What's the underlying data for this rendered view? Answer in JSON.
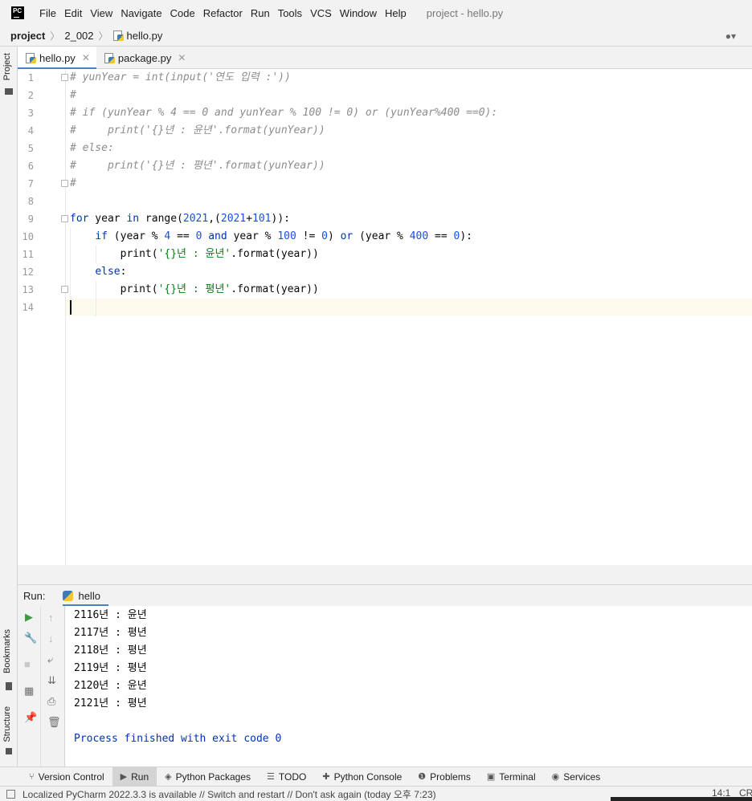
{
  "app": {
    "logo": "PC",
    "title": "project - hello.py"
  },
  "menu": [
    "File",
    "Edit",
    "View",
    "Navigate",
    "Code",
    "Refactor",
    "Run",
    "Tools",
    "VCS",
    "Window",
    "Help"
  ],
  "breadcrumb": {
    "project": "project",
    "folder": "2_002",
    "file": "hello.py"
  },
  "left_stripe": {
    "top": "Project",
    "bookmarks": "Bookmarks",
    "structure": "Structure"
  },
  "tabs": [
    {
      "label": "hello.py",
      "active": true
    },
    {
      "label": "package.py",
      "active": false
    }
  ],
  "line_numbers": [
    "1",
    "2",
    "3",
    "4",
    "5",
    "6",
    "7",
    "8",
    "9",
    "10",
    "11",
    "12",
    "13",
    "14"
  ],
  "code": [
    "# yunYear = int(input('연도 입력 :'))",
    "#",
    "# if (yunYear % 4 == 0 and yunYear % 100 != 0) or (yunYear%400 ==0):",
    "#     print('{}년 : 윤년'.format(yunYear))",
    "# else:",
    "#     print('{}년 : 평년'.format(yunYear))",
    "#",
    "",
    "for year in range(2021,(2021+101)):",
    "    if (year % 4 == 0 and year % 100 != 0) or (year % 400 == 0):",
    "        print('{}년 : 윤년'.format(year))",
    "    else:",
    "        print('{}년 : 평년'.format(year))",
    ""
  ],
  "run": {
    "label": "Run:",
    "tab": "hello",
    "output": [
      "2116년 : 윤년",
      "2117년 : 평년",
      "2118년 : 평년",
      "2119년 : 평년",
      "2120년 : 윤년",
      "2121년 : 평년"
    ],
    "exit_message": "Process finished with exit code 0"
  },
  "bottom_tools": [
    {
      "label": "Version Control",
      "icon": "branch-icon",
      "active": false
    },
    {
      "label": "Run",
      "icon": "run-icon",
      "active": true
    },
    {
      "label": "Python Packages",
      "icon": "layers-icon",
      "active": false
    },
    {
      "label": "TODO",
      "icon": "list-icon",
      "active": false
    },
    {
      "label": "Python Console",
      "icon": "python-console-icon",
      "active": false
    },
    {
      "label": "Problems",
      "icon": "info-icon",
      "active": false
    },
    {
      "label": "Terminal",
      "icon": "terminal-icon",
      "active": false
    },
    {
      "label": "Services",
      "icon": "services-icon",
      "active": false
    }
  ],
  "status": {
    "message": "Localized PyCharm 2022.3.3 is available // Switch and restart // Don't ask again (today 오후 7:23)",
    "position": "14:1",
    "line_ending": "CR"
  },
  "colors": {
    "keyword": "#0033b3",
    "number": "#1750eb",
    "string": "#067d17",
    "comment": "#8c8c8c",
    "accent": "#4083c9",
    "current_line": "#fcfaed"
  }
}
